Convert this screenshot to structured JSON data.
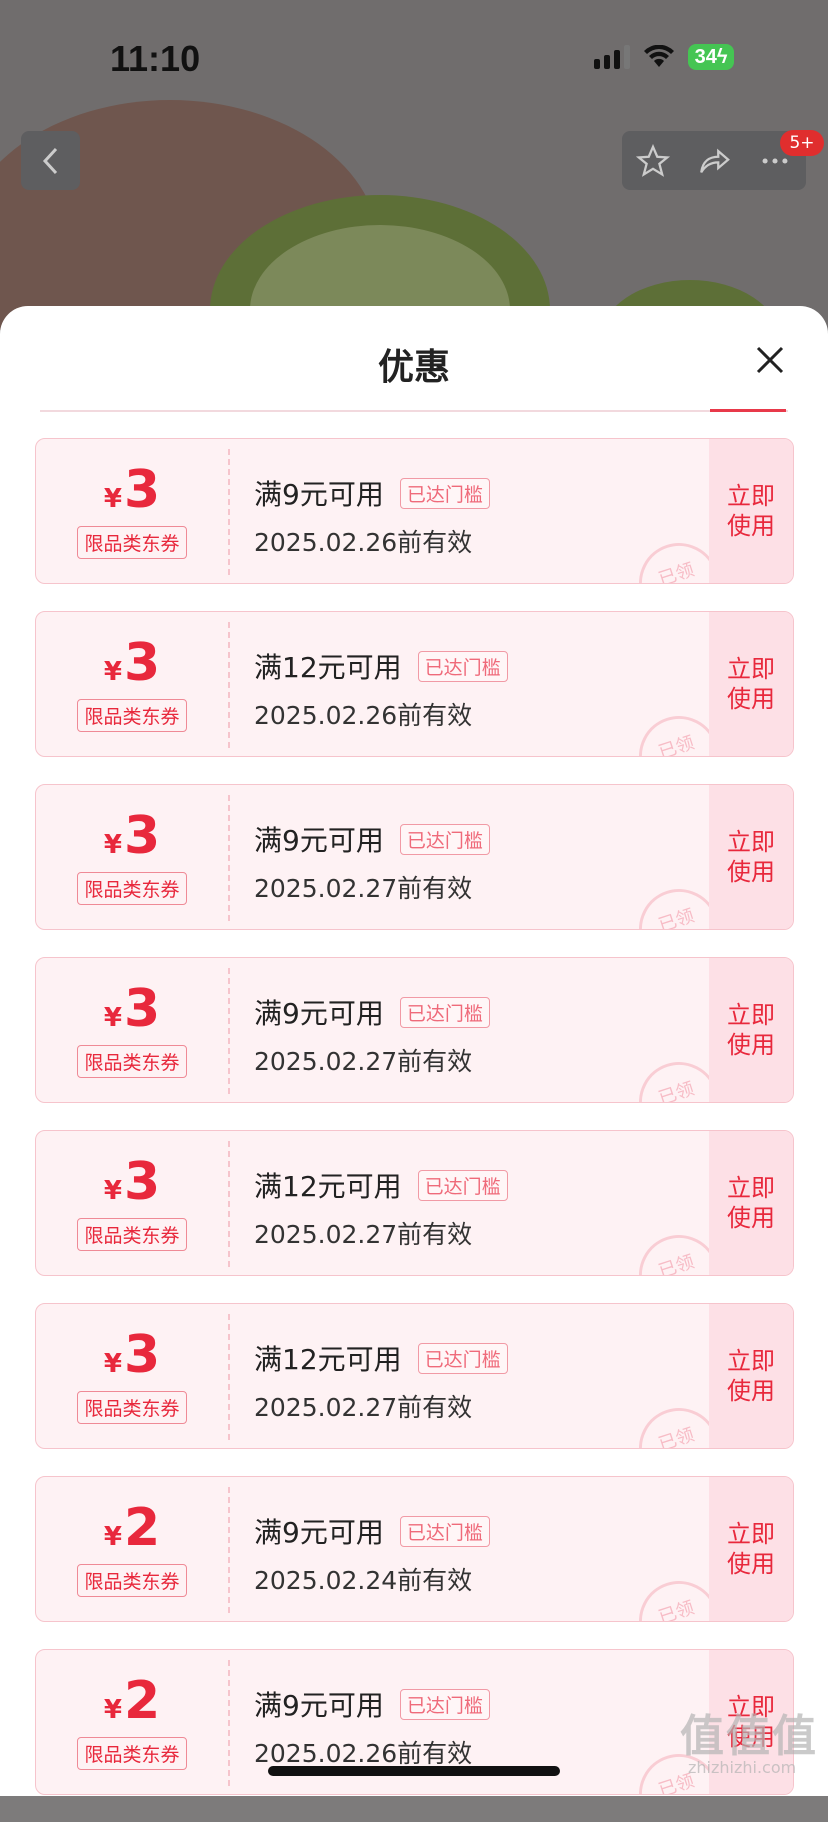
{
  "status_bar": {
    "time": "11:10",
    "battery": "34"
  },
  "header": {
    "more_badge": "5+"
  },
  "sheet": {
    "title": "优惠"
  },
  "coupons": [
    {
      "symbol": "¥",
      "amount": "3",
      "tag": "限品类东券",
      "condition": "满9元可用",
      "threshold": "已达门槛",
      "expiry": "2025.02.26前有效",
      "action": "立即使用",
      "stamp": "已领"
    },
    {
      "symbol": "¥",
      "amount": "3",
      "tag": "限品类东券",
      "condition": "满12元可用",
      "threshold": "已达门槛",
      "expiry": "2025.02.26前有效",
      "action": "立即使用",
      "stamp": "已领"
    },
    {
      "symbol": "¥",
      "amount": "3",
      "tag": "限品类东券",
      "condition": "满9元可用",
      "threshold": "已达门槛",
      "expiry": "2025.02.27前有效",
      "action": "立即使用",
      "stamp": "已领"
    },
    {
      "symbol": "¥",
      "amount": "3",
      "tag": "限品类东券",
      "condition": "满9元可用",
      "threshold": "已达门槛",
      "expiry": "2025.02.27前有效",
      "action": "立即使用",
      "stamp": "已领"
    },
    {
      "symbol": "¥",
      "amount": "3",
      "tag": "限品类东券",
      "condition": "满12元可用",
      "threshold": "已达门槛",
      "expiry": "2025.02.27前有效",
      "action": "立即使用",
      "stamp": "已领"
    },
    {
      "symbol": "¥",
      "amount": "3",
      "tag": "限品类东券",
      "condition": "满12元可用",
      "threshold": "已达门槛",
      "expiry": "2025.02.27前有效",
      "action": "立即使用",
      "stamp": "已领"
    },
    {
      "symbol": "¥",
      "amount": "2",
      "tag": "限品类东券",
      "condition": "满9元可用",
      "threshold": "已达门槛",
      "expiry": "2025.02.24前有效",
      "action": "立即使用",
      "stamp": "已领"
    },
    {
      "symbol": "¥",
      "amount": "2",
      "tag": "限品类东券",
      "condition": "满9元可用",
      "threshold": "已达门槛",
      "expiry": "2025.02.26前有效",
      "action": "立即使用",
      "stamp": "已领"
    }
  ],
  "watermark": {
    "main": "值值值",
    "sub": "zhizhizhi.com"
  },
  "colors": {
    "accent": "#e8283c",
    "coupon_bg": "#fef2f4",
    "coupon_border": "#f6c4cc"
  }
}
